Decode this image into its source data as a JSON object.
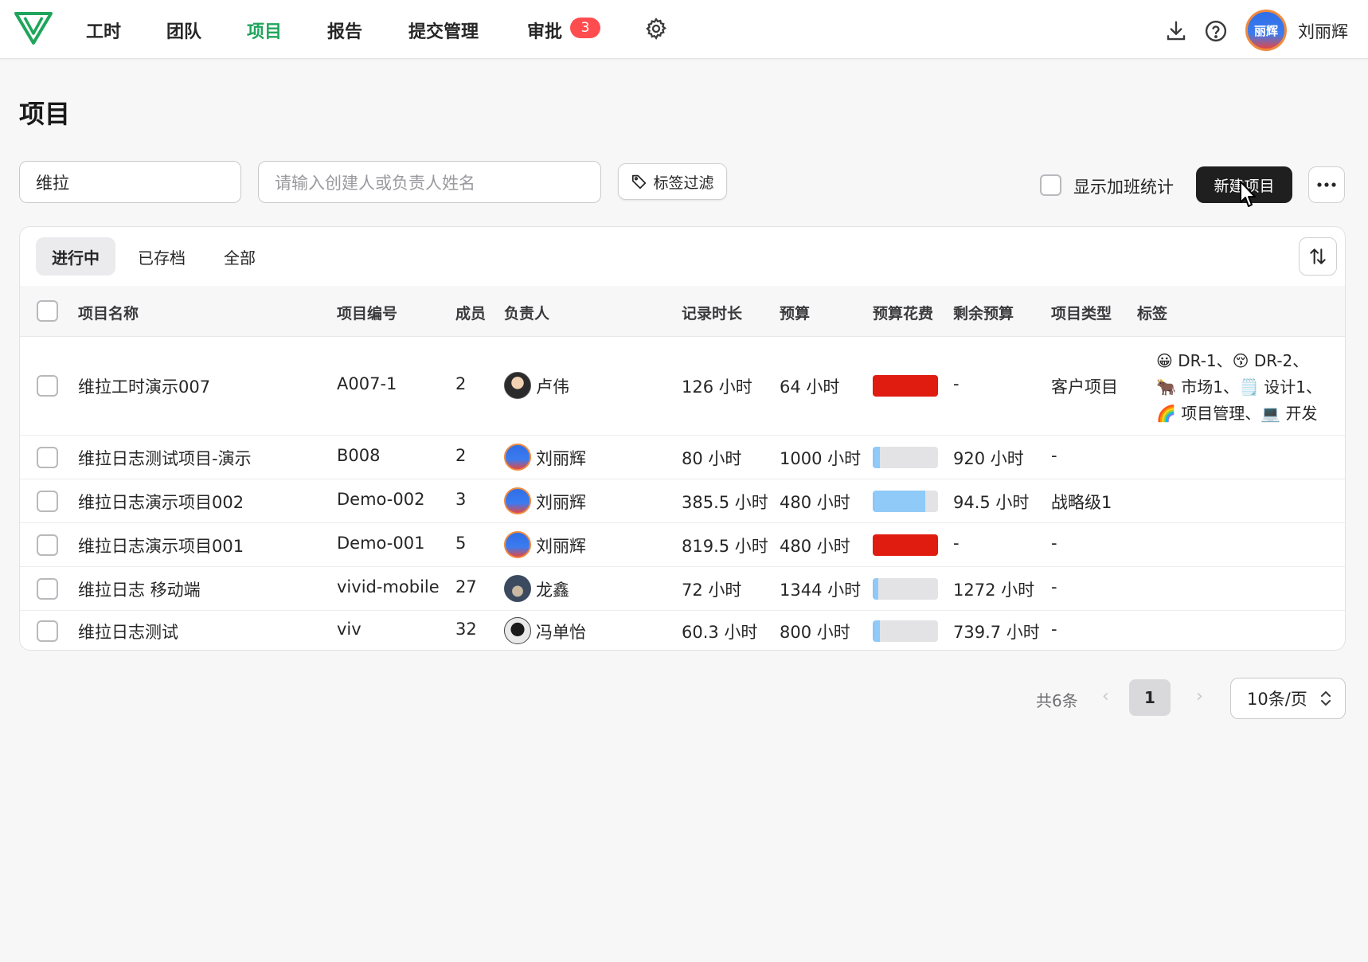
{
  "nav": {
    "items": [
      {
        "label": "工时"
      },
      {
        "label": "团队"
      },
      {
        "label": "项目"
      },
      {
        "label": "报告"
      },
      {
        "label": "提交管理"
      },
      {
        "label": "审批"
      }
    ],
    "approval_badge": "3",
    "avatar_text": "丽辉",
    "username": "刘丽辉",
    "accent_color": "#1fa55b"
  },
  "page": {
    "title": "项目"
  },
  "filters": {
    "search_value": "维拉",
    "person_placeholder": "请输入创建人或负责人姓名",
    "tag_filter_label": "标签过滤",
    "overtime_label": "显示加班统计",
    "new_project_label": "新建项目"
  },
  "tabs": [
    {
      "label": "进行中"
    },
    {
      "label": "已存档"
    },
    {
      "label": "全部"
    }
  ],
  "table": {
    "columns": [
      "项目名称",
      "项目编号",
      "成员",
      "负责人",
      "记录时长",
      "预算",
      "预算花费",
      "剩余预算",
      "项目类型",
      "标签"
    ],
    "rows": [
      {
        "name": "维拉工时演示007",
        "code": "A007-1",
        "members": "2",
        "owner": "卢伟",
        "logged": "126 小时",
        "budget": "64 小时",
        "spent_fraction": 1.0,
        "over_budget": true,
        "remaining": "-",
        "type": "客户项目",
        "tags": [
          "😀 DR-1、😚 DR-2、",
          "🐂 市场1、🗒️ 设计1、",
          "🌈 项目管理、💻 开发"
        ]
      },
      {
        "name": "维拉日志测试项目-演示",
        "code": "B008",
        "members": "2",
        "owner": "刘丽辉",
        "logged": "80 小时",
        "budget": "1000 小时",
        "spent_fraction": 0.08,
        "over_budget": false,
        "remaining": "920 小时",
        "type": "-",
        "tags": []
      },
      {
        "name": "维拉日志演示项目002",
        "code": "Demo-002",
        "members": "3",
        "owner": "刘丽辉",
        "logged": "385.5 小时",
        "budget": "480 小时",
        "spent_fraction": 0.8,
        "over_budget": false,
        "remaining": "94.5 小时",
        "type": "战略级1",
        "tags": []
      },
      {
        "name": "维拉日志演示项目001",
        "code": "Demo-001",
        "members": "5",
        "owner": "刘丽辉",
        "logged": "819.5 小时",
        "budget": "480 小时",
        "spent_fraction": 1.0,
        "over_budget": true,
        "remaining": "-",
        "type": "-",
        "tags": []
      },
      {
        "name": "维拉日志 移动端",
        "code": "vivid-mobile",
        "members": "27",
        "owner": "龙鑫",
        "logged": "72 小时",
        "budget": "1344 小时",
        "spent_fraction": 0.05,
        "over_budget": false,
        "remaining": "1272 小时",
        "type": "-",
        "tags": []
      },
      {
        "name": "维拉日志测试",
        "code": "viv",
        "members": "32",
        "owner": "冯单怡",
        "logged": "60.3 小时",
        "budget": "800 小时",
        "spent_fraction": 0.08,
        "over_budget": false,
        "remaining": "739.7 小时",
        "type": "-",
        "tags": []
      }
    ]
  },
  "pagination": {
    "total_label": "共6条",
    "current_page": "1",
    "page_size_label": "10条/页"
  }
}
